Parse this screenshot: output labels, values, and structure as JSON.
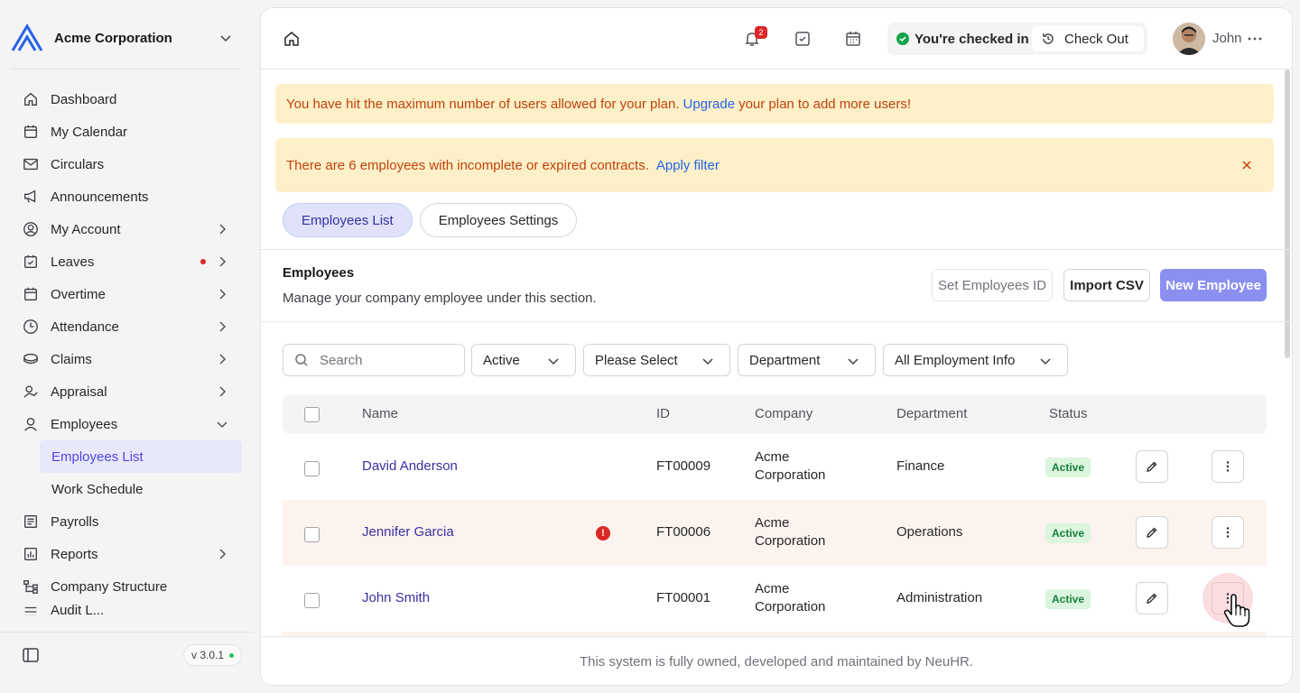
{
  "company": {
    "name": "Acme Corporation"
  },
  "sidebar": {
    "items": [
      {
        "label": "Dashboard",
        "icon": "home-icon"
      },
      {
        "label": "My Calendar",
        "icon": "calendar-icon"
      },
      {
        "label": "Circulars",
        "icon": "mail-icon"
      },
      {
        "label": "Announcements",
        "icon": "megaphone-icon"
      },
      {
        "label": "My Account",
        "icon": "user-circle-icon"
      },
      {
        "label": "Leaves",
        "icon": "calendar-check-icon"
      },
      {
        "label": "Overtime",
        "icon": "calendar-icon"
      },
      {
        "label": "Attendance",
        "icon": "clock-icon"
      },
      {
        "label": "Claims",
        "icon": "coins-icon"
      },
      {
        "label": "Appraisal",
        "icon": "user-check-icon"
      },
      {
        "label": "Employees",
        "icon": "user-icon"
      },
      {
        "label": "Payrolls",
        "icon": "receipt-icon"
      },
      {
        "label": "Reports",
        "icon": "report-icon"
      },
      {
        "label": "Company Structure",
        "icon": "hierarchy-icon"
      },
      {
        "label": "Audit L...",
        "icon": "list-icon"
      }
    ],
    "employees_sub": [
      "Employees List",
      "Work Schedule"
    ],
    "version": "v 3.0.1"
  },
  "topbar": {
    "notification_count": "2",
    "checkin_status": "You're checked in",
    "checkout_label": "Check Out",
    "user_name": "John"
  },
  "alerts": {
    "limit_before": "You have hit the maximum number of users allowed for your plan.",
    "limit_link": "Upgrade",
    "limit_after": "your plan to add more users!",
    "contracts_text": "There are 6 employees with incomplete or expired contracts.",
    "contracts_link": "Apply filter"
  },
  "tabs": [
    "Employees List",
    "Employees Settings"
  ],
  "section": {
    "title": "Employees",
    "description": "Manage your company employee under this section.",
    "buttons": {
      "set_id": "Set Employees ID",
      "import": "Import CSV",
      "new": "New Employee"
    }
  },
  "filters": {
    "search_placeholder": "Search",
    "status": "Active",
    "select": "Please Select",
    "department": "Department",
    "employment": "All Employment Info"
  },
  "table": {
    "headers": {
      "name": "Name",
      "id": "ID",
      "company": "Company",
      "department": "Department",
      "status": "Status"
    },
    "rows": [
      {
        "name": "David Anderson",
        "id": "FT00009",
        "company_line1": "Acme",
        "company_line2": "Corporation",
        "department": "Finance",
        "status": "Active"
      },
      {
        "name": "Jennifer Garcia",
        "id": "FT00006",
        "company_line1": "Acme",
        "company_line2": "Corporation",
        "department": "Operations",
        "status": "Active",
        "warning": "!"
      },
      {
        "name": "John Smith",
        "id": "FT00001",
        "company_line1": "Acme",
        "company_line2": "Corporation",
        "department": "Administration",
        "status": "Active"
      }
    ]
  },
  "footer": {
    "text": "This system is fully owned, developed and maintained by NeuHR."
  },
  "colors": {
    "accent": "#4f46e5",
    "primary_button": "#8b8ff0",
    "alert_bg": "#fdf0c8",
    "alert_text": "#c2410c",
    "active_badge_bg": "#dcf5dd"
  }
}
